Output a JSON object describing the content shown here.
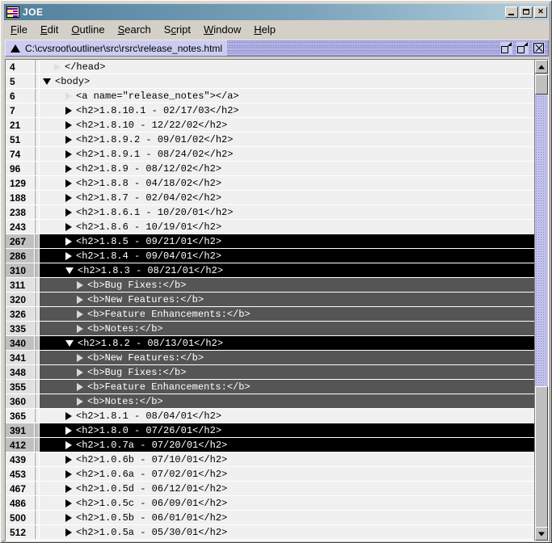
{
  "window": {
    "title": "JOE",
    "app_icon": "document-lines-icon",
    "controls": {
      "minimize": "minimize-button",
      "maximize": "maximize-button",
      "close": "close-button"
    }
  },
  "menubar": {
    "items": [
      {
        "label": "File",
        "mnemonic": "F"
      },
      {
        "label": "Edit",
        "mnemonic": "E"
      },
      {
        "label": "Outline",
        "mnemonic": "O"
      },
      {
        "label": "Search",
        "mnemonic": "S"
      },
      {
        "label": "Script",
        "mnemonic": "c"
      },
      {
        "label": "Window",
        "mnemonic": "W"
      },
      {
        "label": "Help",
        "mnemonic": "H"
      }
    ]
  },
  "pathbar": {
    "path": "C:\\cvsroot\\outliner\\src\\rsrc\\release_notes.html",
    "marker_icon": "triangle-up-icon",
    "tools": [
      {
        "name": "restore-window-icon"
      },
      {
        "name": "maximize-window-icon"
      },
      {
        "name": "close-document-icon"
      }
    ]
  },
  "outline": {
    "rows": [
      {
        "line": "4",
        "text": "</head>",
        "depth": 1,
        "tri": "right",
        "tri_style": "light",
        "state": "normal"
      },
      {
        "line": "5",
        "text": "<body>",
        "depth": 0,
        "tri": "down",
        "tri_style": "solid",
        "state": "normal"
      },
      {
        "line": "6",
        "text": "<a name=\"release_notes\"></a>",
        "depth": 2,
        "tri": "right",
        "tri_style": "light",
        "state": "normal"
      },
      {
        "line": "7",
        "text": "<h2>1.8.10.1 - 02/17/03</h2>",
        "depth": 2,
        "tri": "right",
        "tri_style": "solid",
        "state": "normal"
      },
      {
        "line": "21",
        "text": "<h2>1.8.10 - 12/22/02</h2>",
        "depth": 2,
        "tri": "right",
        "tri_style": "solid",
        "state": "normal"
      },
      {
        "line": "51",
        "text": "<h2>1.8.9.2 - 09/01/02</h2>",
        "depth": 2,
        "tri": "right",
        "tri_style": "solid",
        "state": "normal"
      },
      {
        "line": "74",
        "text": "<h2>1.8.9.1 - 08/24/02</h2>",
        "depth": 2,
        "tri": "right",
        "tri_style": "solid",
        "state": "normal"
      },
      {
        "line": "96",
        "text": "<h2>1.8.9 - 08/12/02</h2>",
        "depth": 2,
        "tri": "right",
        "tri_style": "solid",
        "state": "normal"
      },
      {
        "line": "129",
        "text": "<h2>1.8.8 - 04/18/02</h2>",
        "depth": 2,
        "tri": "right",
        "tri_style": "solid",
        "state": "normal"
      },
      {
        "line": "188",
        "text": "<h2>1.8.7 - 02/04/02</h2>",
        "depth": 2,
        "tri": "right",
        "tri_style": "solid",
        "state": "normal"
      },
      {
        "line": "238",
        "text": "<h2>1.8.6.1 - 10/20/01</h2>",
        "depth": 2,
        "tri": "right",
        "tri_style": "solid",
        "state": "normal"
      },
      {
        "line": "243",
        "text": "<h2>1.8.6 - 10/19/01</h2>",
        "depth": 2,
        "tri": "right",
        "tri_style": "solid",
        "state": "normal"
      },
      {
        "line": "267",
        "text": "<h2>1.8.5 - 09/21/01</h2>",
        "depth": 2,
        "tri": "right",
        "tri_style": "solid",
        "state": "selected"
      },
      {
        "line": "286",
        "text": "<h2>1.8.4 - 09/04/01</h2>",
        "depth": 2,
        "tri": "right",
        "tri_style": "solid",
        "state": "selected"
      },
      {
        "line": "310",
        "text": "<h2>1.8.3 - 08/21/01</h2>",
        "depth": 2,
        "tri": "down",
        "tri_style": "solid",
        "state": "selected"
      },
      {
        "line": "311",
        "text": "<b>Bug Fixes:</b>",
        "depth": 3,
        "tri": "right",
        "tri_style": "solid",
        "state": "child"
      },
      {
        "line": "320",
        "text": "<b>New Features:</b>",
        "depth": 3,
        "tri": "right",
        "tri_style": "solid",
        "state": "child"
      },
      {
        "line": "326",
        "text": "<b>Feature Enhancements:</b>",
        "depth": 3,
        "tri": "right",
        "tri_style": "solid",
        "state": "child"
      },
      {
        "line": "335",
        "text": "<b>Notes:</b>",
        "depth": 3,
        "tri": "right",
        "tri_style": "solid",
        "state": "child"
      },
      {
        "line": "340",
        "text": "<h2>1.8.2 - 08/13/01</h2>",
        "depth": 2,
        "tri": "down",
        "tri_style": "solid",
        "state": "selected"
      },
      {
        "line": "341",
        "text": "<b>New Features:</b>",
        "depth": 3,
        "tri": "right",
        "tri_style": "solid",
        "state": "child"
      },
      {
        "line": "348",
        "text": "<b>Bug Fixes:</b>",
        "depth": 3,
        "tri": "right",
        "tri_style": "solid",
        "state": "child"
      },
      {
        "line": "355",
        "text": "<b>Feature Enhancements:</b>",
        "depth": 3,
        "tri": "right",
        "tri_style": "solid",
        "state": "child"
      },
      {
        "line": "360",
        "text": "<b>Notes:</b>",
        "depth": 3,
        "tri": "right",
        "tri_style": "solid",
        "state": "child"
      },
      {
        "line": "365",
        "text": "<h2>1.8.1 - 08/04/01</h2>",
        "depth": 2,
        "tri": "right",
        "tri_style": "solid",
        "state": "normal"
      },
      {
        "line": "391",
        "text": "<h2>1.8.0 - 07/26/01</h2>",
        "depth": 2,
        "tri": "right",
        "tri_style": "solid",
        "state": "selected"
      },
      {
        "line": "412",
        "text": "<h2>1.0.7a - 07/20/01</h2>",
        "depth": 2,
        "tri": "right",
        "tri_style": "solid",
        "state": "selected"
      },
      {
        "line": "439",
        "text": "<h2>1.0.6b - 07/10/01</h2>",
        "depth": 2,
        "tri": "right",
        "tri_style": "solid",
        "state": "normal"
      },
      {
        "line": "453",
        "text": "<h2>1.0.6a - 07/02/01</h2>",
        "depth": 2,
        "tri": "right",
        "tri_style": "solid",
        "state": "normal"
      },
      {
        "line": "467",
        "text": "<h2>1.0.5d - 06/12/01</h2>",
        "depth": 2,
        "tri": "right",
        "tri_style": "solid",
        "state": "normal"
      },
      {
        "line": "486",
        "text": "<h2>1.0.5c - 06/09/01</h2>",
        "depth": 2,
        "tri": "right",
        "tri_style": "solid",
        "state": "normal"
      },
      {
        "line": "500",
        "text": "<h2>1.0.5b - 06/01/01</h2>",
        "depth": 2,
        "tri": "right",
        "tri_style": "solid",
        "state": "normal"
      },
      {
        "line": "512",
        "text": "<h2>1.0.5a - 05/30/01</h2>",
        "depth": 2,
        "tri": "right",
        "tri_style": "solid",
        "state": "normal"
      }
    ]
  },
  "scrollbar": {
    "up_arrow": "scroll-up-icon",
    "down_arrow": "scroll-down-icon"
  },
  "colors": {
    "title_gradient_start": "#52809c",
    "title_gradient_end": "#b5cfde",
    "chrome": "#d4d0c8",
    "pathbar": "#c8c8ee",
    "row_normal": "#f0f0f0",
    "row_selected": "#000000",
    "row_child": "#555555",
    "gutter_selected": "#c0c0c0"
  }
}
